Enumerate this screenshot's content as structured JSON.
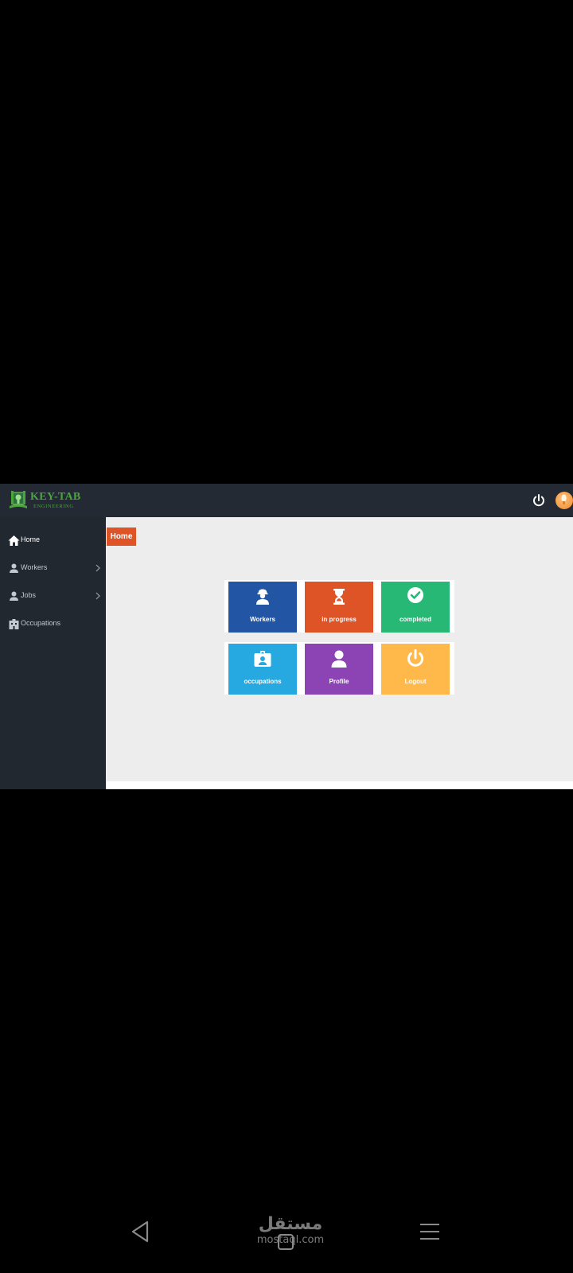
{
  "brand": {
    "title": "KEY-TAB",
    "subtitle": "ENGINEERING",
    "color": "#4aa63c"
  },
  "topbar": {
    "power_icon": "power-icon",
    "avatar_icon": "lightbulb-avatar-icon"
  },
  "sidebar": {
    "items": [
      {
        "label": "Home",
        "icon": "home-icon",
        "active": true
      },
      {
        "label": "Workers",
        "icon": "user-icon",
        "has_submenu": true
      },
      {
        "label": "Jobs",
        "icon": "user-icon",
        "has_submenu": true
      },
      {
        "label": "Occupations",
        "icon": "building-icon"
      }
    ]
  },
  "breadcrumb": {
    "label": "Home",
    "color": "#df5426"
  },
  "tiles": [
    {
      "label": "Workers",
      "icon": "worker-icon",
      "color": "#2255a4"
    },
    {
      "label": "in progress",
      "icon": "hourglass-icon",
      "color": "#df5426"
    },
    {
      "label": "completed",
      "icon": "check-circle-icon",
      "color": "#27b876"
    },
    {
      "label": "occupations",
      "icon": "id-badge-icon",
      "color": "#26a8e0"
    },
    {
      "label": "Profile",
      "icon": "user-icon",
      "color": "#8c44b4"
    },
    {
      "label": "Logout",
      "icon": "power-icon",
      "color": "#feb94a"
    }
  ],
  "watermark": {
    "arabic": "مستقل",
    "latin": "mostaql.com"
  },
  "system_nav": {
    "back_icon": "back-triangle-icon",
    "home_icon": "home-square-icon",
    "menu_icon": "menu-lines-icon"
  }
}
